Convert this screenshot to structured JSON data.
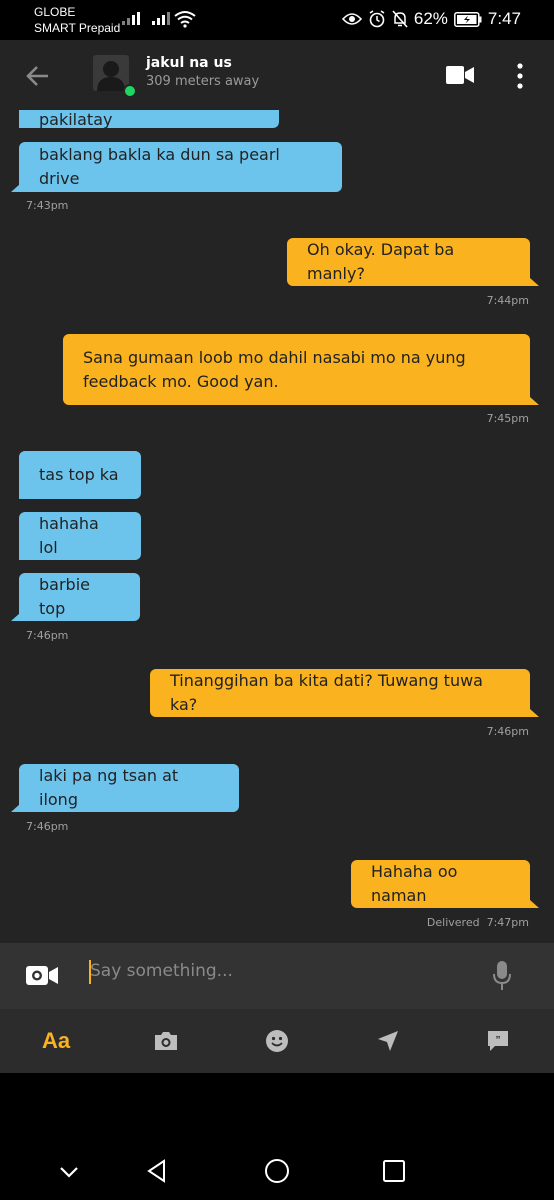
{
  "status": {
    "carrier1": "GLOBE",
    "carrier2": "SMART Prepaid",
    "battery": "62%",
    "time": "7:47"
  },
  "header": {
    "name": "jakul na us",
    "distance": "309 meters away"
  },
  "messages": [
    {
      "text": "pangbahay pero di pakilatay",
      "dir": "in"
    },
    {
      "text": "baklang bakla ka dun sa pearl drive",
      "dir": "in",
      "time": "7:43pm"
    },
    {
      "text": "Oh okay. Dapat ba manly?",
      "dir": "out",
      "time": "7:44pm"
    },
    {
      "line1": "Sana gumaan loob mo dahil nasabi mo na yung",
      "line2": "feedback mo. Good yan.",
      "dir": "out",
      "time": "7:45pm"
    },
    {
      "text": "tas top ka",
      "dir": "in"
    },
    {
      "text": "hahaha lol",
      "dir": "in"
    },
    {
      "text": "barbie top",
      "dir": "in",
      "time": "7:46pm"
    },
    {
      "text": "Tinanggihan ba kita dati? Tuwang tuwa ka?",
      "dir": "out",
      "time": "7:46pm"
    },
    {
      "text": "laki pa ng tsan at ilong",
      "dir": "in",
      "time": "7:46pm"
    },
    {
      "text": "Hahaha oo naman",
      "dir": "out",
      "status": "Delivered",
      "time": "7:47pm"
    }
  ],
  "composer": {
    "placeholder": "Say something...",
    "text_tab_label": "Aa"
  },
  "colors": {
    "incoming": "#6cc4ed",
    "outgoing": "#fab21e",
    "background": "#242424",
    "online": "#1ed760"
  }
}
